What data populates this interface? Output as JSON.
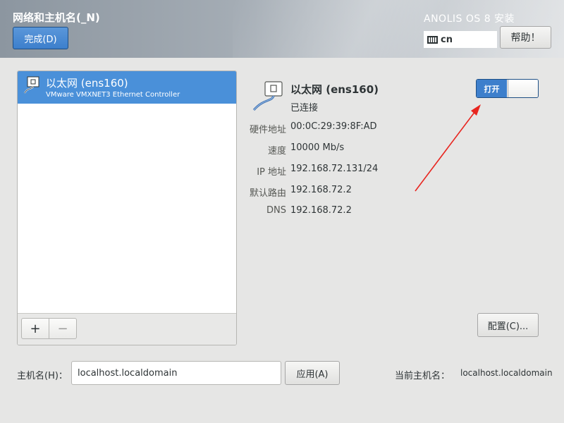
{
  "header": {
    "title": "网络和主机名(_N)",
    "done_label": "完成(D)",
    "product": "ANOLIS OS 8 安装",
    "keyboard_layout": "cn",
    "help_label": "帮助！"
  },
  "device_list": {
    "items": [
      {
        "name": "以太网 (ens160)",
        "description": "VMware VMXNET3 Ethernet Controller",
        "selected": true
      }
    ],
    "add_label": "+",
    "remove_label": "−"
  },
  "details": {
    "name": "以太网 (ens160)",
    "status": "已连接",
    "toggle_label": "打开",
    "toggle_on": true,
    "rows": [
      {
        "label": "硬件地址",
        "value": "00:0C:29:39:8F:AD"
      },
      {
        "label": "速度",
        "value": "10000 Mb/s"
      },
      {
        "label": "IP 地址",
        "value": "192.168.72.131/24"
      },
      {
        "label": "默认路由",
        "value": "192.168.72.2"
      },
      {
        "label": "DNS",
        "value": "192.168.72.2"
      }
    ],
    "configure_label": "配置(C)..."
  },
  "hostname": {
    "label": "主机名(H)：",
    "value": "localhost.localdomain",
    "apply_label": "应用(A)",
    "current_label": "当前主机名：",
    "current_value": "localhost.localdomain"
  },
  "colors": {
    "accent": "#4a90d9",
    "annotation_arrow": "#e8251f"
  },
  "icons": [
    "keyboard-icon",
    "ethernet-icon",
    "red-annotation-arrow"
  ]
}
